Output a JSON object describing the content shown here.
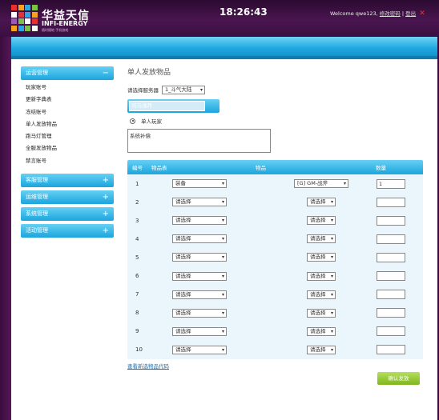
{
  "header": {
    "brand_cn": "华益天信",
    "brand_en": "INFI-ENERGY",
    "brand_sub": "随时随地 手机游戏",
    "clock": "18:26:43",
    "welcome_prefix": "Welcome qwe123,",
    "change_password": "修改密码",
    "separator": "|",
    "logout": "登出",
    "close_icon": "✕",
    "logo_colors": [
      "#e8312f",
      "#f7a21b",
      "#2aa7e0",
      "#7cc242",
      "#ffffff",
      "#e8312f",
      "#2aa7e0",
      "#f7a21b",
      "#9b59b6",
      "#7cc242",
      "#ffffff",
      "#e8312f",
      "#f7a21b",
      "#2aa7e0",
      "#7cc242",
      "#ffffff"
    ]
  },
  "sidebar": {
    "groups": [
      {
        "label": "运营管理",
        "toggle": "−",
        "items": [
          "玩家账号",
          "更新字典表",
          "冻结账号",
          "单人发放物品",
          "跑马灯管理",
          "全服发放物品",
          "禁言账号"
        ]
      },
      {
        "label": "客服管理",
        "toggle": "+"
      },
      {
        "label": "运维管理",
        "toggle": "+"
      },
      {
        "label": "系统管理",
        "toggle": "+"
      },
      {
        "label": "活动管理",
        "toggle": "+"
      }
    ]
  },
  "main": {
    "title": "单人发放物品",
    "server_label": "请选择服务器",
    "server_value": "1_斗气大陆",
    "tab_value": "司马浅月",
    "radio_label": "单人玩家",
    "textarea_value": "系统补偿",
    "table": {
      "headers": [
        "编号",
        "物品表",
        "物品",
        "数量"
      ],
      "rows": [
        {
          "no": "1",
          "table": "装备",
          "item": "[G] GM-战斧",
          "qty": "1"
        },
        {
          "no": "2",
          "table": "请选择",
          "item": "请选择",
          "qty": ""
        },
        {
          "no": "3",
          "table": "请选择",
          "item": "请选择",
          "qty": ""
        },
        {
          "no": "4",
          "table": "请选择",
          "item": "请选择",
          "qty": ""
        },
        {
          "no": "5",
          "table": "请选择",
          "item": "请选择",
          "qty": ""
        },
        {
          "no": "6",
          "table": "请选择",
          "item": "请选择",
          "qty": ""
        },
        {
          "no": "7",
          "table": "请选择",
          "item": "请选择",
          "qty": ""
        },
        {
          "no": "8",
          "table": "请选择",
          "item": "请选择",
          "qty": ""
        },
        {
          "no": "9",
          "table": "请选择",
          "item": "请选择",
          "qty": ""
        },
        {
          "no": "10",
          "table": "请选择",
          "item": "请选择",
          "qty": ""
        }
      ]
    },
    "link": "查看新选物品代码",
    "confirm_button": "确认发放"
  }
}
